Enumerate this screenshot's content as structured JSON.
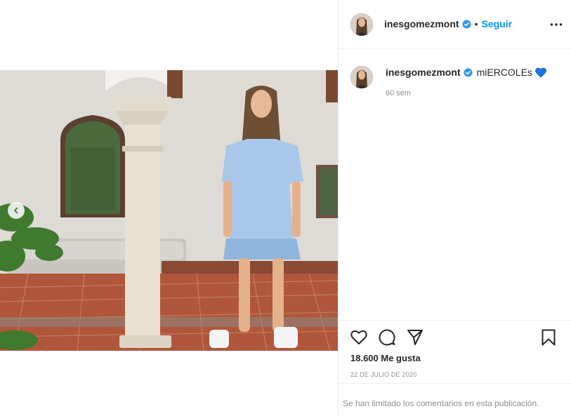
{
  "post": {
    "username": "inesgomezmont",
    "verified": true,
    "follow_label": "Seguir",
    "separator": "•",
    "caption_text": "miERCʘLEs",
    "caption_emoji": "blue-heart-icon",
    "caption_time": "60 sem",
    "likes": "18.600 Me gusta",
    "date": "22 DE JULIO DE 2020",
    "comments_notice": "Se han limitado los comentarios en esta publicación."
  },
  "icons": {
    "more": "more-options-icon",
    "like": "heart-outline-icon",
    "comment": "comment-icon",
    "share": "paper-plane-icon",
    "save": "bookmark-icon",
    "carousel_prev": "chevron-left-icon",
    "verified": "verified-badge-icon"
  },
  "colors": {
    "accent": "#0095f6",
    "text": "#262626",
    "muted": "#8e8e8e",
    "divider": "#efefef",
    "heart_emoji": "#1877f2"
  }
}
